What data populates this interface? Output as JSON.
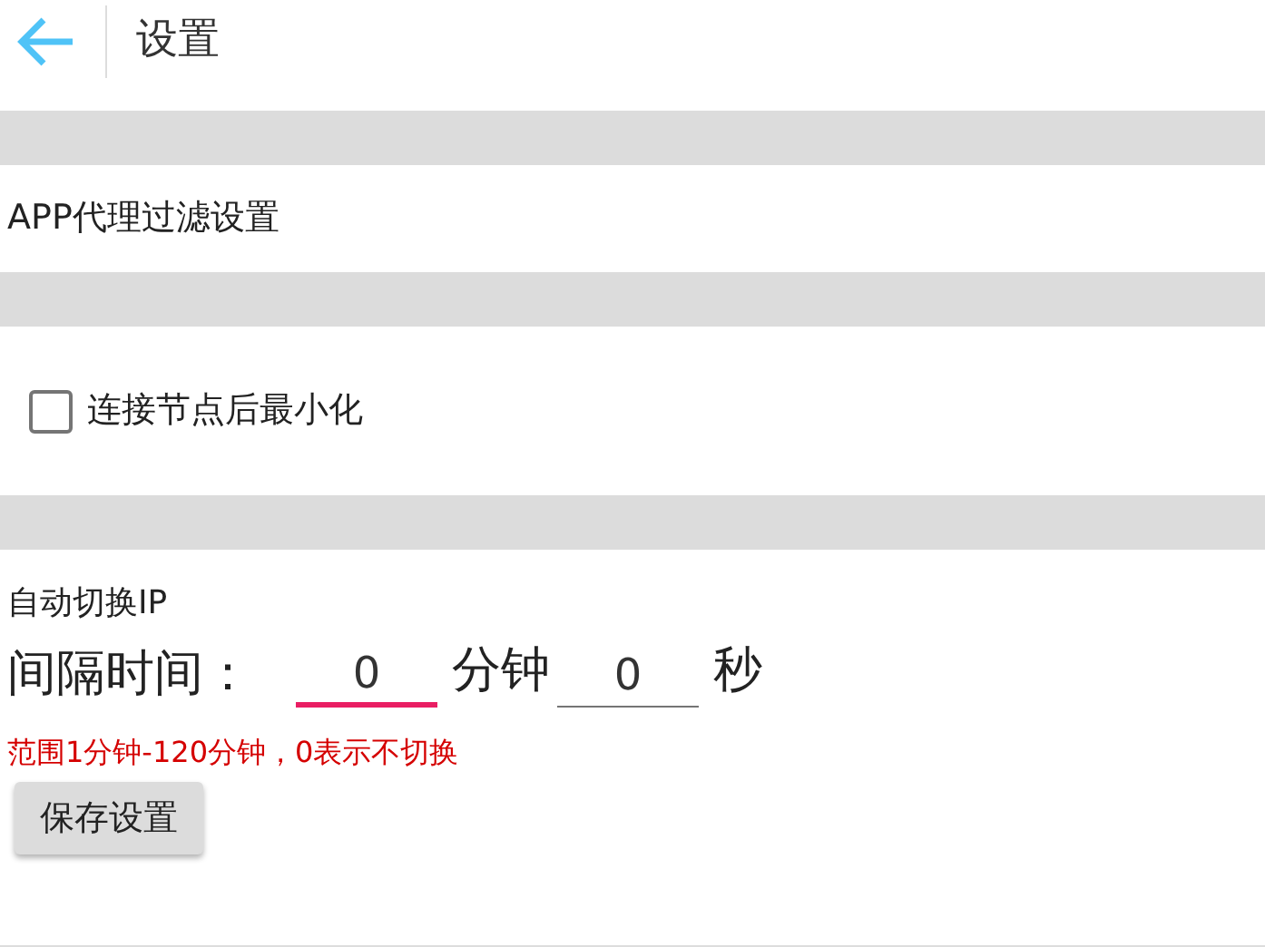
{
  "header": {
    "title": "设置"
  },
  "proxy_filter": {
    "label": "APP代理过滤设置"
  },
  "minimize_option": {
    "label": "连接节点后最小化",
    "checked": false
  },
  "auto_switch": {
    "title": "自动切换IP",
    "interval_label": "间隔时间：",
    "fields": [
      {
        "value": "0",
        "unit": "分钟",
        "focused": true
      },
      {
        "value": "0",
        "unit": "秒",
        "focused": false
      }
    ],
    "hint": "范围1分钟-120分钟，0表示不切换",
    "save_button": "保存设置"
  }
}
